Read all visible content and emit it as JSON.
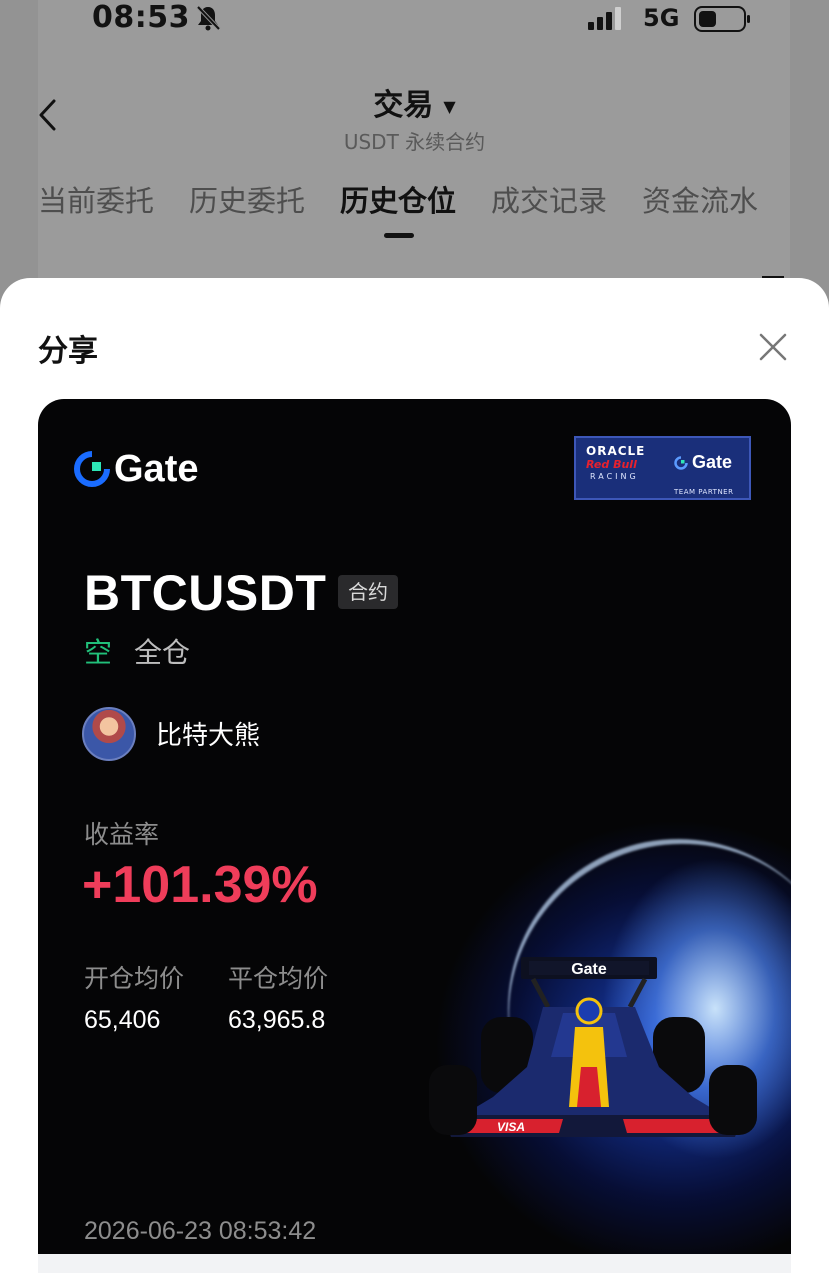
{
  "status_bar": {
    "time": "08:53",
    "network": "5G",
    "icons": [
      "bell-muted-icon",
      "signal-icon",
      "battery-icon"
    ]
  },
  "nav": {
    "title": "交易",
    "subtitle": "USDT 永续合约",
    "back_icon": "chevron-left-icon",
    "title_caret_icon": "caret-down-icon"
  },
  "tabs": [
    {
      "label": "当前委托",
      "active": false
    },
    {
      "label": "历史委托",
      "active": false
    },
    {
      "label": "历史仓位",
      "active": true
    },
    {
      "label": "成交记录",
      "active": false
    },
    {
      "label": "资金流水",
      "active": false
    }
  ],
  "share_sheet": {
    "title": "分享",
    "close_icon": "close-icon"
  },
  "card": {
    "brand": "Gate",
    "partner": {
      "line1": "ORACLE",
      "line2": "Red Bull",
      "line3": "RACING",
      "brand": "Gate",
      "caption": "TEAM PARTNER"
    },
    "symbol": "BTCUSDT",
    "contract_tag": "合约",
    "side": "空",
    "margin_mode": "全仓",
    "username": "比特大熊",
    "yield_label": "收益率",
    "yield_value": "+101.39%",
    "open_price_label": "开仓均价",
    "close_price_label": "平仓均价",
    "open_price": "65,406",
    "close_price": "63,965.8",
    "car_livery": "Gate",
    "car_sponsor": "VISA",
    "timestamp": "2026-06-23 08:53:42"
  },
  "colors": {
    "positive_green": "#21c07a",
    "yield_red": "#ef3d5a",
    "card_bg": "#050506",
    "brand_blue": "#1a6cff"
  }
}
